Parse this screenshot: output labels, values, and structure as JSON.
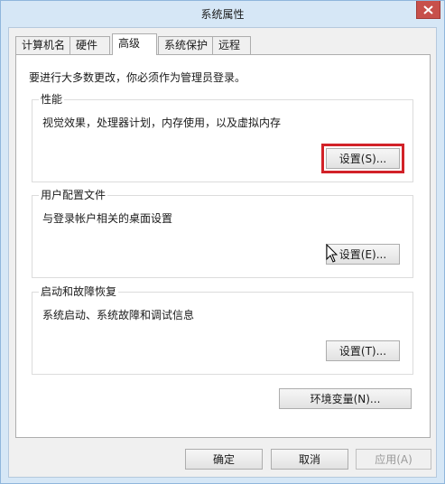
{
  "window": {
    "title": "系统属性"
  },
  "tabs": [
    {
      "label": "计算机名"
    },
    {
      "label": "硬件"
    },
    {
      "label": "高级"
    },
    {
      "label": "系统保护"
    },
    {
      "label": "远程"
    }
  ],
  "active_tab": "高级",
  "intro_text": "要进行大多数更改，你必须作为管理员登录。",
  "performance": {
    "title": "性能",
    "description": "视觉效果，处理器计划，内存使用，以及虚拟内存",
    "button": "设置(S)..."
  },
  "user_profile": {
    "title": "用户配置文件",
    "description": "与登录帐户相关的桌面设置",
    "button": "设置(E)..."
  },
  "startup_recovery": {
    "title": "启动和故障恢复",
    "description": "系统启动、系统故障和调试信息",
    "button": "设置(T)..."
  },
  "env_button": "环境变量(N)...",
  "footer": {
    "ok": "确定",
    "cancel": "取消",
    "apply": "应用(A)"
  },
  "colors": {
    "highlight_border": "#d22228",
    "close_button": "#c7504b",
    "frame": "#d6e7f6"
  },
  "icons": [
    "close-icon",
    "mouse-cursor-icon"
  ]
}
